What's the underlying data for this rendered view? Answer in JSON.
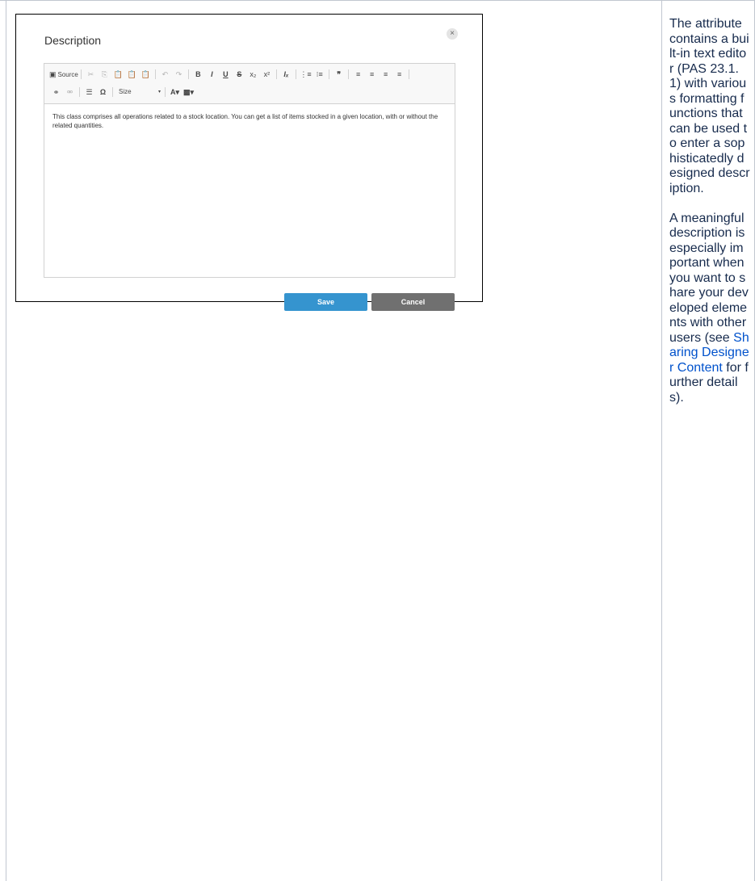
{
  "dialog": {
    "title": "Description",
    "close_label": "×",
    "toolbar": {
      "source_label": "Source",
      "size_label": "Size",
      "size_caret": "▾",
      "cut": "✂",
      "copy": "⎘",
      "paste": "📋",
      "paste_text": "📋",
      "paste_word": "📋",
      "undo": "↶",
      "redo": "↷",
      "bold": "B",
      "italic": "I",
      "underline": "U",
      "strike": "S",
      "subscript": "x₂",
      "superscript": "x²",
      "remove_format": "Iₓ",
      "numbered_list": "⋮≡",
      "bulleted_list": "⁝≡",
      "blockquote": "❞",
      "align_left": "≡",
      "align_center": "≡",
      "align_right": "≡",
      "justify": "≡",
      "link": "⚭",
      "unlink": "⚮",
      "horizontal_rule": "☰",
      "special_char": "Ω",
      "text_color": "A▾",
      "bg_color": "▩▾"
    },
    "content": "This class comprises all operations related to a stock location. You can get a list of items stocked in a given location, with or without the related quantities.",
    "save_label": "Save",
    "cancel_label": "Cancel"
  },
  "note": {
    "paragraph1": "The attribute contains a built-in text editor (PAS 23.1.1) with various formatting functions that can be used to enter a sophisticatedly designed description.",
    "paragraph2_before": "A meaningful description is especially important when you want to share your developed elements with other users (see ",
    "link_text": "Sharing Designer Content",
    "paragraph2_after": " for further details)."
  }
}
